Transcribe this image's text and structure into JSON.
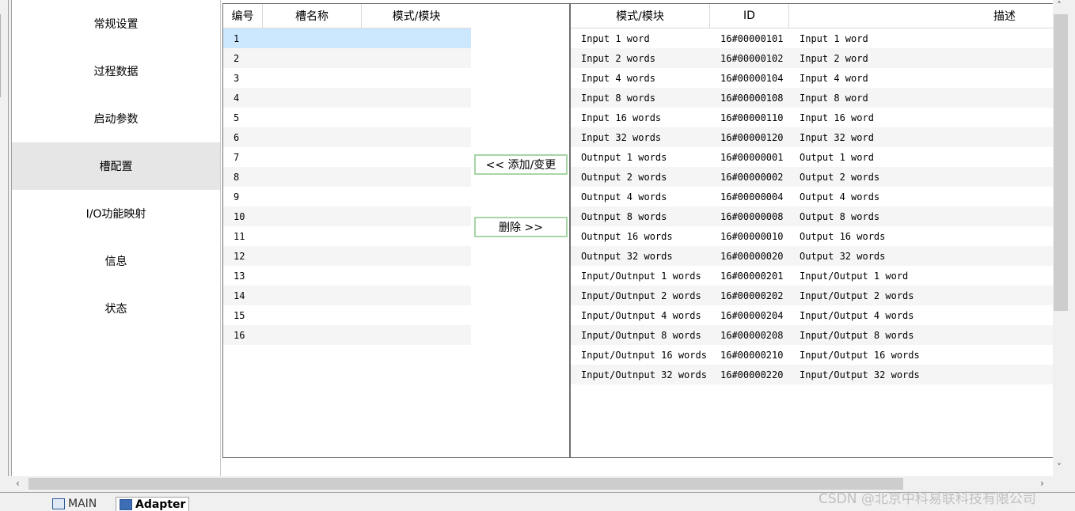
{
  "nav": {
    "items": [
      {
        "label": "常规设置"
      },
      {
        "label": "过程数据"
      },
      {
        "label": "启动参数"
      },
      {
        "label": "槽配置"
      },
      {
        "label": "I/O功能映射"
      },
      {
        "label": "信息"
      },
      {
        "label": "状态"
      }
    ],
    "active": "槽配置"
  },
  "slot_table": {
    "headers": [
      "编号",
      "槽名称",
      "模式/模块"
    ],
    "rows": [
      "1",
      "2",
      "3",
      "4",
      "5",
      "6",
      "7",
      "8",
      "9",
      "10",
      "11",
      "12",
      "13",
      "14",
      "15",
      "16"
    ],
    "selected": "1"
  },
  "actions": {
    "add_label": "<< 添加/变更",
    "delete_label": "删除 >>"
  },
  "module_table": {
    "headers": [
      "模式/模块",
      "ID",
      "描述"
    ],
    "rows": [
      {
        "module": "Input 1 word",
        "id": "16#00000101",
        "desc": "Input 1 word"
      },
      {
        "module": "Input 2 words",
        "id": "16#00000102",
        "desc": "Input 2 word"
      },
      {
        "module": "Input 4 words",
        "id": "16#00000104",
        "desc": "Input 4 word"
      },
      {
        "module": "Input 8 words",
        "id": "16#00000108",
        "desc": "Input 8 word"
      },
      {
        "module": "Input 16 words",
        "id": "16#00000110",
        "desc": "Input 16 word"
      },
      {
        "module": "Input 32 words",
        "id": "16#00000120",
        "desc": "Input 32 word"
      },
      {
        "module": "Outnput 1 words",
        "id": "16#00000001",
        "desc": "Output 1 word"
      },
      {
        "module": "Outnput 2 words",
        "id": "16#00000002",
        "desc": "Output 2 words"
      },
      {
        "module": "Outnput 4 words",
        "id": "16#00000004",
        "desc": "Output 4 words"
      },
      {
        "module": "Outnput 8 words",
        "id": "16#00000008",
        "desc": "Output 8 words"
      },
      {
        "module": "Outnput 16 words",
        "id": "16#00000010",
        "desc": "Output 16 words"
      },
      {
        "module": "Outnput 32 words",
        "id": "16#00000020",
        "desc": "Output 32 words"
      },
      {
        "module": "Input/Outnput 1 words",
        "id": "16#00000201",
        "desc": "Input/Output 1 word"
      },
      {
        "module": "Input/Outnput 2 words",
        "id": "16#00000202",
        "desc": "Input/Output 2 words"
      },
      {
        "module": "Input/Outnput 4 words",
        "id": "16#00000204",
        "desc": "Input/Output 4 words"
      },
      {
        "module": "Input/Outnput 8 words",
        "id": "16#00000208",
        "desc": "Input/Output 8 words"
      },
      {
        "module": "Input/Outnput 16 words",
        "id": "16#00000210",
        "desc": "Input/Output 16 words"
      },
      {
        "module": "Input/Outnput 32 words",
        "id": "16#00000220",
        "desc": "Input/Output 32 words"
      }
    ]
  },
  "tabs": [
    {
      "label": "MAIN",
      "icon": "document-icon"
    },
    {
      "label": "Adapter",
      "icon": "device-icon"
    }
  ],
  "watermark": "CSDN @北京中科易联科技有限公司",
  "colors": {
    "selected_row": "#cce8ff",
    "active_nav": "#e6e6e6",
    "button_border": "#a7d5a7"
  }
}
